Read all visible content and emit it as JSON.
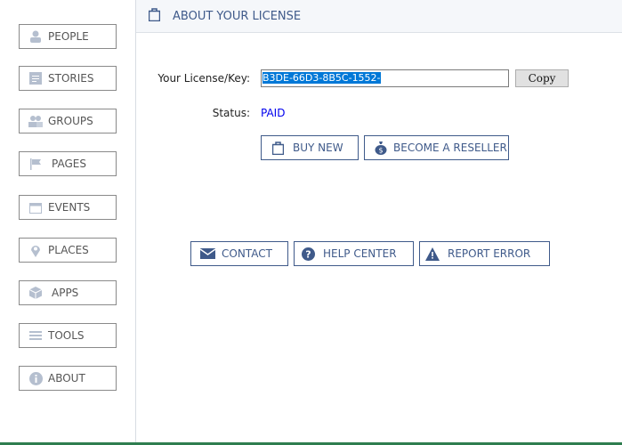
{
  "sidebar": {
    "items": [
      {
        "label": "PEOPLE",
        "icon": "person-icon"
      },
      {
        "label": "STORIES",
        "icon": "document-icon"
      },
      {
        "label": "GROUPS",
        "icon": "group-icon"
      },
      {
        "label": "PAGES",
        "icon": "flag-icon"
      },
      {
        "label": "EVENTS",
        "icon": "calendar-icon"
      },
      {
        "label": "PLACES",
        "icon": "map-pin-icon"
      },
      {
        "label": "APPS",
        "icon": "cube-icon"
      },
      {
        "label": "TOOLS",
        "icon": "menu-icon"
      },
      {
        "label": "ABOUT",
        "icon": "info-icon"
      }
    ]
  },
  "header": {
    "title": "ABOUT YOUR LICENSE"
  },
  "license": {
    "key_label": "Your License/Key:",
    "key_value": "B3DE-66D3-8B5C-1552-",
    "copy_label": "Copy",
    "status_label": "Status:",
    "status_value": "PAID"
  },
  "actions": {
    "buy_new": "BUY NEW",
    "reseller": "BECOME A RESELLER",
    "contact": "CONTACT",
    "help": "HELP CENTER",
    "report": "REPORT ERROR"
  },
  "colors": {
    "accent": "#3f5a8a",
    "status": "#0000ee",
    "selection": "#0078d7"
  }
}
